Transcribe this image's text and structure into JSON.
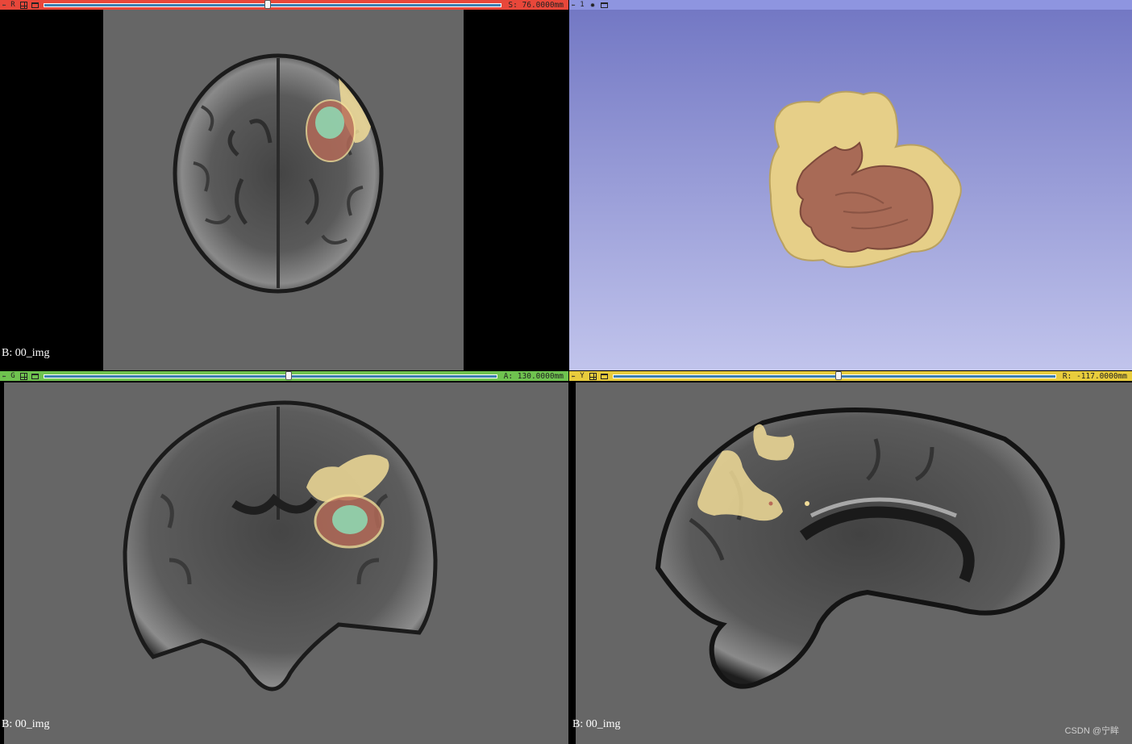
{
  "colors": {
    "red_bar": "#e8473a",
    "green_bar": "#6fc34f",
    "yellow_bar": "#e8cc3c",
    "blue_bar": "#8e95e0",
    "slice_background": "#666666",
    "threed_top": "#7378c4",
    "threed_bottom": "#c1c4ec",
    "seg_edema": "#f1dc98",
    "seg_core": "#b86b58",
    "seg_enhancing": "#8fd6b0"
  },
  "red_view": {
    "orientation_letter": "R",
    "offset_label": "S: 76.0000mm",
    "slider_fraction": 0.49,
    "background_label": "B: 00_img"
  },
  "threed_view": {
    "view_number": "1"
  },
  "green_view": {
    "orientation_letter": "G",
    "offset_label": "A: 130.0000mm",
    "slider_fraction": 0.54,
    "background_label": "B: 00_img"
  },
  "yellow_view": {
    "orientation_letter": "Y",
    "offset_label": "R: -117.0000mm",
    "slider_fraction": 0.51,
    "background_label": "B: 00_img"
  },
  "watermark": "CSDN @宁眸",
  "icons": {
    "pin": "pin-icon",
    "link": "link-icon",
    "layout": "view-layout-icon",
    "center": "center-view-icon"
  }
}
